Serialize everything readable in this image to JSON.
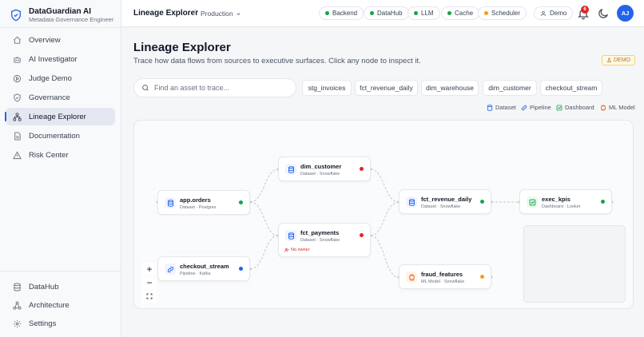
{
  "brand": {
    "name": "DataGuardian AI",
    "subtitle": "Metadata Governance Engineer"
  },
  "sidebar": {
    "items": [
      {
        "label": "Overview",
        "icon": "home-icon"
      },
      {
        "label": "AI Investigator",
        "icon": "robot-icon"
      },
      {
        "label": "Judge Demo",
        "icon": "play-circle-icon"
      },
      {
        "label": "Governance",
        "icon": "shield-check-icon"
      },
      {
        "label": "Lineage Explorer",
        "icon": "network-icon",
        "active": true
      },
      {
        "label": "Documentation",
        "icon": "document-icon"
      },
      {
        "label": "Risk Center",
        "icon": "warning-icon"
      }
    ],
    "footer_items": [
      {
        "label": "DataHub",
        "icon": "database-icon"
      },
      {
        "label": "Architecture",
        "icon": "architecture-icon"
      },
      {
        "label": "Settings",
        "icon": "gear-icon"
      }
    ]
  },
  "header": {
    "title": "Lineage Explorer",
    "separator": "/",
    "environment": "Production",
    "status_pills": [
      {
        "label": "Backend",
        "color": "#16a34a"
      },
      {
        "label": "DataHub",
        "color": "#16a34a"
      },
      {
        "label": "LLM",
        "color": "#16a34a"
      },
      {
        "label": "Cache",
        "color": "#16a34a"
      },
      {
        "label": "Scheduler",
        "color": "#f59e0b"
      }
    ],
    "user_label": "Demo",
    "notification_count": "6",
    "avatar_initials": "AJ"
  },
  "page": {
    "title": "Lineage Explorer",
    "subtitle": "Trace how data flows from sources to executive surfaces. Click any node to inspect it.",
    "demo_badge": "DEMO"
  },
  "search": {
    "placeholder": "Find an asset to trace...",
    "value": ""
  },
  "quick_chips": [
    "stg_invoices",
    "fct_revenue_daily",
    "dim_warehouse",
    "dim_customer",
    "checkout_stream"
  ],
  "legend": [
    {
      "label": "Dataset",
      "icon": "database-icon",
      "color": "#2563eb"
    },
    {
      "label": "Pipeline",
      "icon": "link-icon",
      "color": "#2563eb"
    },
    {
      "label": "Dashboard",
      "icon": "dashboard-icon",
      "color": "#16a34a"
    },
    {
      "label": "ML Model",
      "icon": "model-icon",
      "color": "#ea580c"
    }
  ],
  "lineage": {
    "nodes": [
      {
        "id": "app_orders",
        "name": "app.orders",
        "meta": "Dataset · Postgres",
        "kind": "dataset",
        "status_color": "#16a34a"
      },
      {
        "id": "checkout_stream",
        "name": "checkout_stream",
        "meta": "Pipeline · Kafka",
        "kind": "pipeline",
        "status_color": "#2563eb"
      },
      {
        "id": "dim_customer",
        "name": "dim_customer",
        "meta": "Dataset · Snowflake",
        "kind": "dataset",
        "status_color": "#dc2626"
      },
      {
        "id": "fct_payments",
        "name": "fct_payments",
        "meta": "Dataset · Snowflake",
        "kind": "dataset",
        "status_color": "#dc2626",
        "warning": "No owner"
      },
      {
        "id": "fct_revenue_daily",
        "name": "fct_revenue_daily",
        "meta": "Dataset · Snowflake",
        "kind": "dataset",
        "status_color": "#16a34a"
      },
      {
        "id": "fraud_features",
        "name": "fraud_features",
        "meta": "ML Model · Snowflake",
        "kind": "model",
        "status_color": "#f59e0b"
      },
      {
        "id": "exec_kpis",
        "name": "exec_kpis",
        "meta": "Dashboard · Looker",
        "kind": "dashboard",
        "status_color": "#16a34a"
      }
    ],
    "edges": [
      [
        "app_orders",
        "dim_customer"
      ],
      [
        "app_orders",
        "fct_payments"
      ],
      [
        "checkout_stream",
        "fct_payments"
      ],
      [
        "dim_customer",
        "fct_revenue_daily"
      ],
      [
        "fct_payments",
        "fct_revenue_daily"
      ],
      [
        "fct_payments",
        "fraud_features"
      ],
      [
        "fct_revenue_daily",
        "exec_kpis"
      ]
    ]
  },
  "zoom_controls": {
    "zoom_in": "+",
    "zoom_out": "−"
  }
}
